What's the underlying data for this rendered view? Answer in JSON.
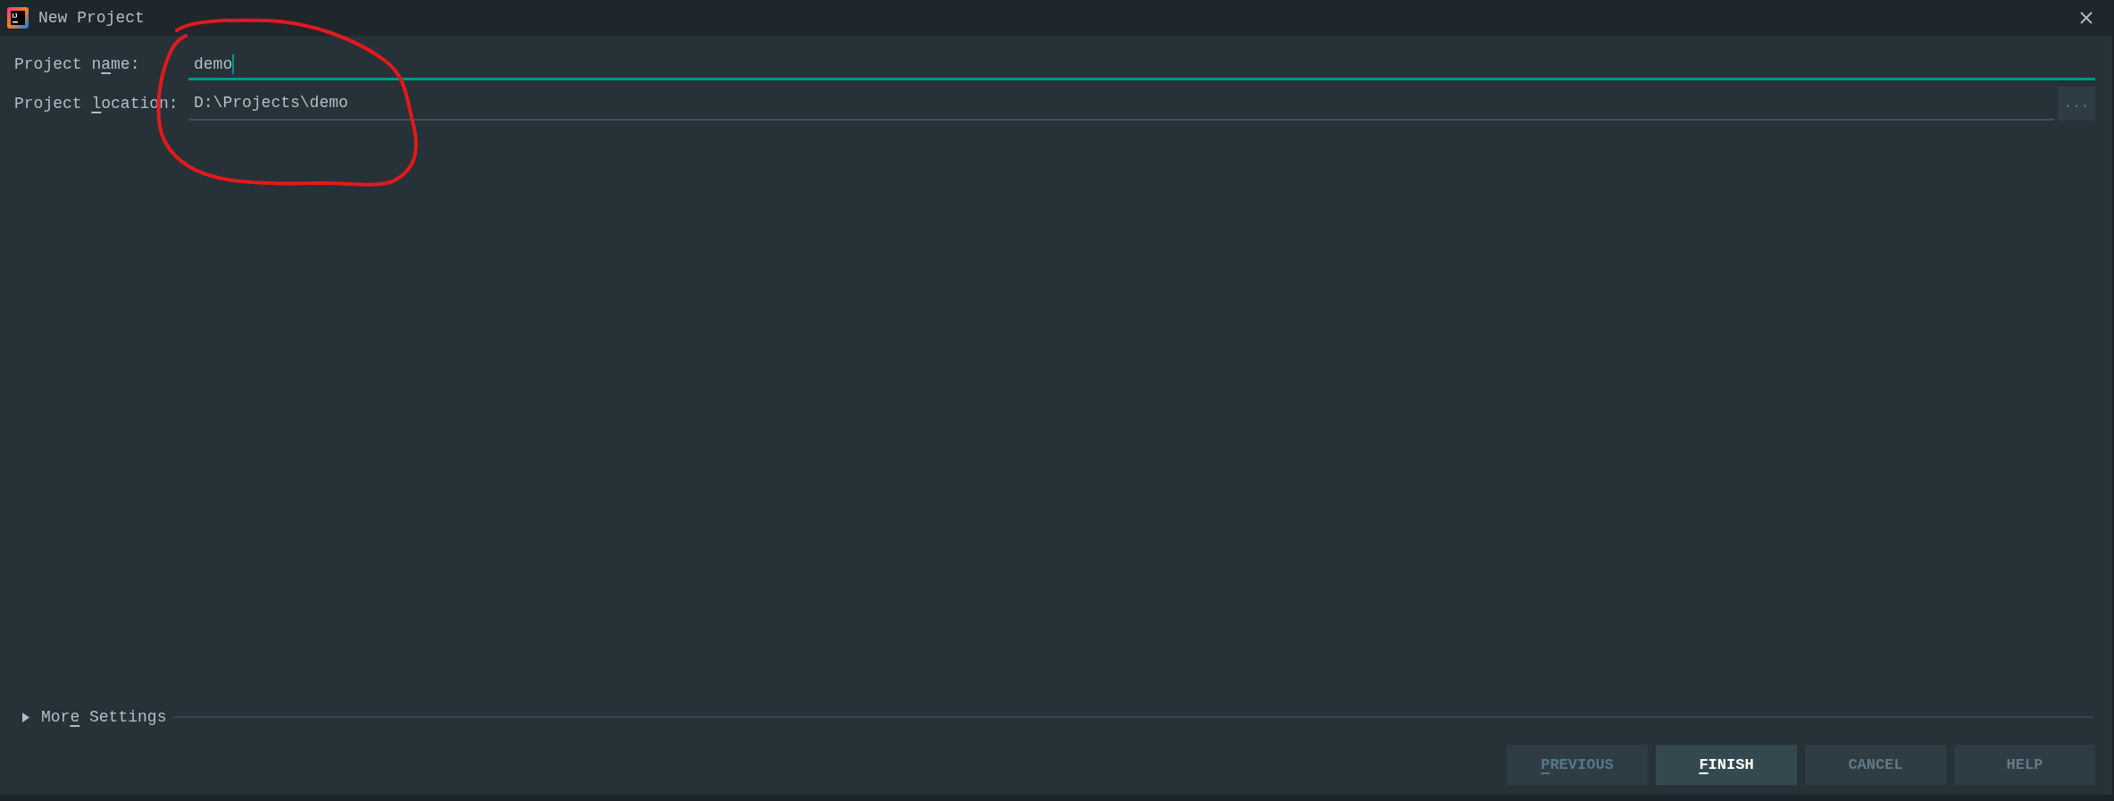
{
  "window": {
    "title": "New Project",
    "icon_label": "IJ"
  },
  "fields": [
    {
      "label": [
        {
          "text": "Project n",
          "underlined": false
        },
        {
          "text": "a",
          "underlined": true
        },
        {
          "text": "me:",
          "underlined": false
        }
      ],
      "value": "demo",
      "focused": true
    },
    {
      "label": [
        {
          "text": "Project ",
          "underlined": false
        },
        {
          "text": "l",
          "underlined": true
        },
        {
          "text": "ocation:",
          "underlined": false
        }
      ],
      "value": "D:\\Projects\\demo",
      "focused": false,
      "browse_button": "..."
    }
  ],
  "more_settings": {
    "label": [
      {
        "text": "Mor",
        "underlined": false
      },
      {
        "text": "e",
        "underlined": true
      },
      {
        "text": " Settings",
        "underlined": false
      }
    ],
    "expanded": false
  },
  "buttons": [
    {
      "label": [
        {
          "text": "P",
          "underlined": true
        },
        {
          "text": "REVIOUS",
          "underlined": false
        }
      ],
      "disabled": true,
      "default": false
    },
    {
      "label": [
        {
          "text": "F",
          "underlined": true
        },
        {
          "text": "INISH",
          "underlined": false
        }
      ],
      "disabled": false,
      "default": true
    },
    {
      "label": [
        {
          "text": "CANCEL",
          "underlined": false
        }
      ],
      "disabled": false,
      "default": false
    },
    {
      "label": [
        {
          "text": "HELP",
          "underlined": false
        }
      ],
      "disabled": false,
      "default": false
    }
  ],
  "annotations": [
    {
      "kind": "loop"
    }
  ]
}
